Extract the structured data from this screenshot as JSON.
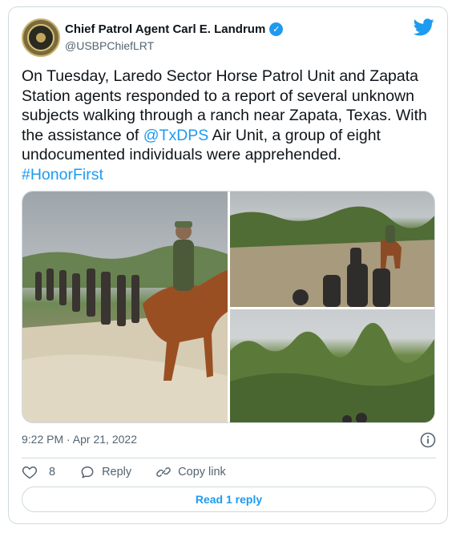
{
  "author": {
    "display_name": "Chief Patrol Agent Carl E. Landrum",
    "handle": "@USBPChiefLRT",
    "verified": true,
    "verified_icon": "verified-badge-icon"
  },
  "tweet": {
    "text_segments": [
      "On Tuesday, Laredo Sector Horse Patrol Unit and Zapata Station agents responded to a report of several unknown subjects walking through a ranch near Zapata, Texas. With the assistance of ",
      "@TxDPS",
      " Air Unit, a group of eight undocumented individuals were apprehended.",
      "#HonorFirst"
    ]
  },
  "media": {
    "photo_count": 3,
    "icons": [
      "photo-horse-patrol-group",
      "photo-patrol-in-brush",
      "photo-brush-landscape"
    ]
  },
  "meta": {
    "timestamp": "9:22 PM · Apr 21, 2022",
    "info_icon": "info-icon"
  },
  "actions": {
    "like_count": "8",
    "reply_label": "Reply",
    "copy_link_label": "Copy link"
  },
  "read_replies_label": "Read 1 reply",
  "colors": {
    "accent": "#1d9bf0",
    "text": "#0f1419",
    "muted": "#536471",
    "border": "#cfd9de"
  }
}
